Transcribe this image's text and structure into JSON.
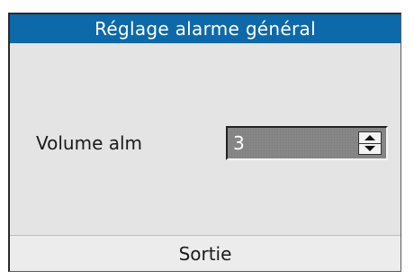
{
  "dialog": {
    "title": "Réglage alarme général"
  },
  "volume": {
    "label": "Volume alm",
    "value": "3"
  },
  "footer": {
    "exit_label": "Sortie"
  },
  "icons": {
    "spin_up": "triangle-up-icon",
    "spin_down": "triangle-down-icon"
  },
  "colors": {
    "title_bar": "#0d69a9",
    "background": "#e4e4e4"
  }
}
